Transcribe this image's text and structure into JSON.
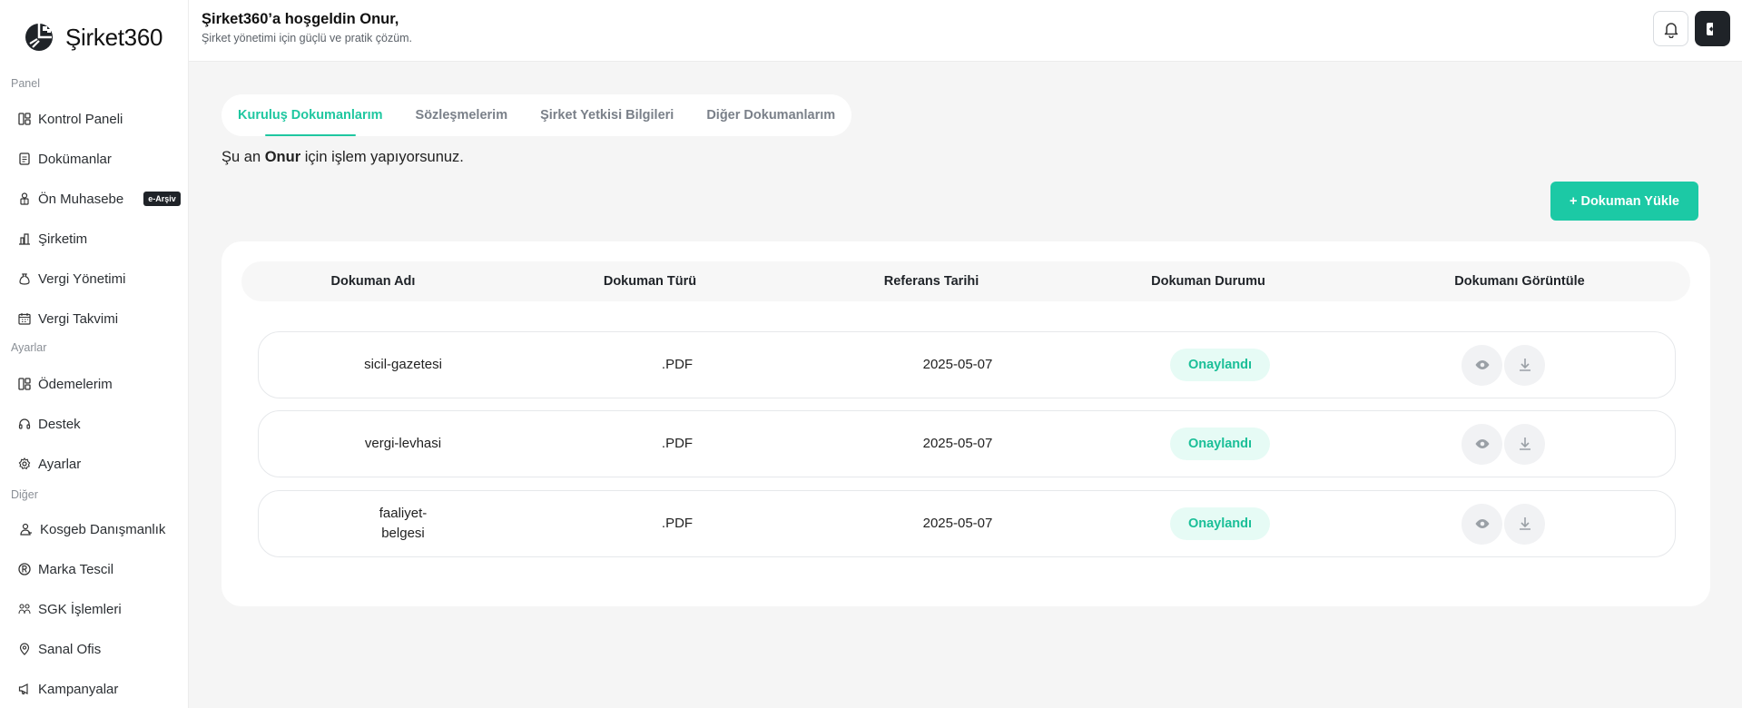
{
  "brand": {
    "name": "Şirket360"
  },
  "sidebar": {
    "sections": [
      "Panel",
      "Ayarlar",
      "Diğer"
    ],
    "items": [
      {
        "label": "Kontrol Paneli",
        "icon": "dashboard-icon"
      },
      {
        "label": "Dokümanlar",
        "icon": "document-icon"
      },
      {
        "label": "Ön Muhasebe",
        "icon": "accountant-icon",
        "badge": "e-Arşiv"
      },
      {
        "label": "Şirketim",
        "icon": "building-icon"
      },
      {
        "label": "Vergi Yönetimi",
        "icon": "money-bag-icon"
      },
      {
        "label": "Vergi Takvimi",
        "icon": "calendar-icon"
      },
      {
        "label": "Ödemelerim",
        "icon": "payments-icon"
      },
      {
        "label": "Destek",
        "icon": "headset-icon"
      },
      {
        "label": "Ayarlar",
        "icon": "gear-icon"
      },
      {
        "label": "Kosgeb Danışmanlık",
        "icon": "consultant-icon"
      },
      {
        "label": "Marka Tescil",
        "icon": "registered-icon"
      },
      {
        "label": "SGK İşlemleri",
        "icon": "people-icon"
      },
      {
        "label": "Sanal Ofis",
        "icon": "location-icon"
      },
      {
        "label": "Kampanyalar",
        "icon": "megaphone-icon"
      }
    ]
  },
  "header": {
    "welcome": "Şirket360’a hoşgeldin Onur,",
    "subtitle": "Şirket yönetimi için güçlü ve pratik çözüm."
  },
  "tabs": [
    {
      "label": "Kuruluş Dokumanlarım",
      "active": true
    },
    {
      "label": "Sözleşmelerim",
      "active": false
    },
    {
      "label": "Şirket Yetkisi Bilgileri",
      "active": false
    },
    {
      "label": "Diğer Dokumanlarım",
      "active": false
    }
  ],
  "notice": {
    "prefix": "Şu an",
    "user": "Onur",
    "suffix": "için işlem yapıyorsunuz."
  },
  "upload_button": "+ Dokuman Yükle",
  "table": {
    "columns": [
      "Dokuman Adı",
      "Dokuman Türü",
      "Referans Tarihi",
      "Dokuman Durumu",
      "Dokumanı Görüntüle"
    ],
    "rows": [
      {
        "name": "sicil-gazetesi",
        "type": ".PDF",
        "date": "2025-05-07",
        "status": "Onaylandı"
      },
      {
        "name": "vergi-levhasi",
        "type": ".PDF",
        "date": "2025-05-07",
        "status": "Onaylandı"
      },
      {
        "name": "faaliyet-belgesi",
        "type": ".PDF",
        "date": "2025-05-07",
        "status": "Onaylandı"
      }
    ]
  },
  "colors": {
    "accent": "#1cc9a5",
    "status_bg": "#e6fbf5",
    "dark": "#1f2328"
  }
}
